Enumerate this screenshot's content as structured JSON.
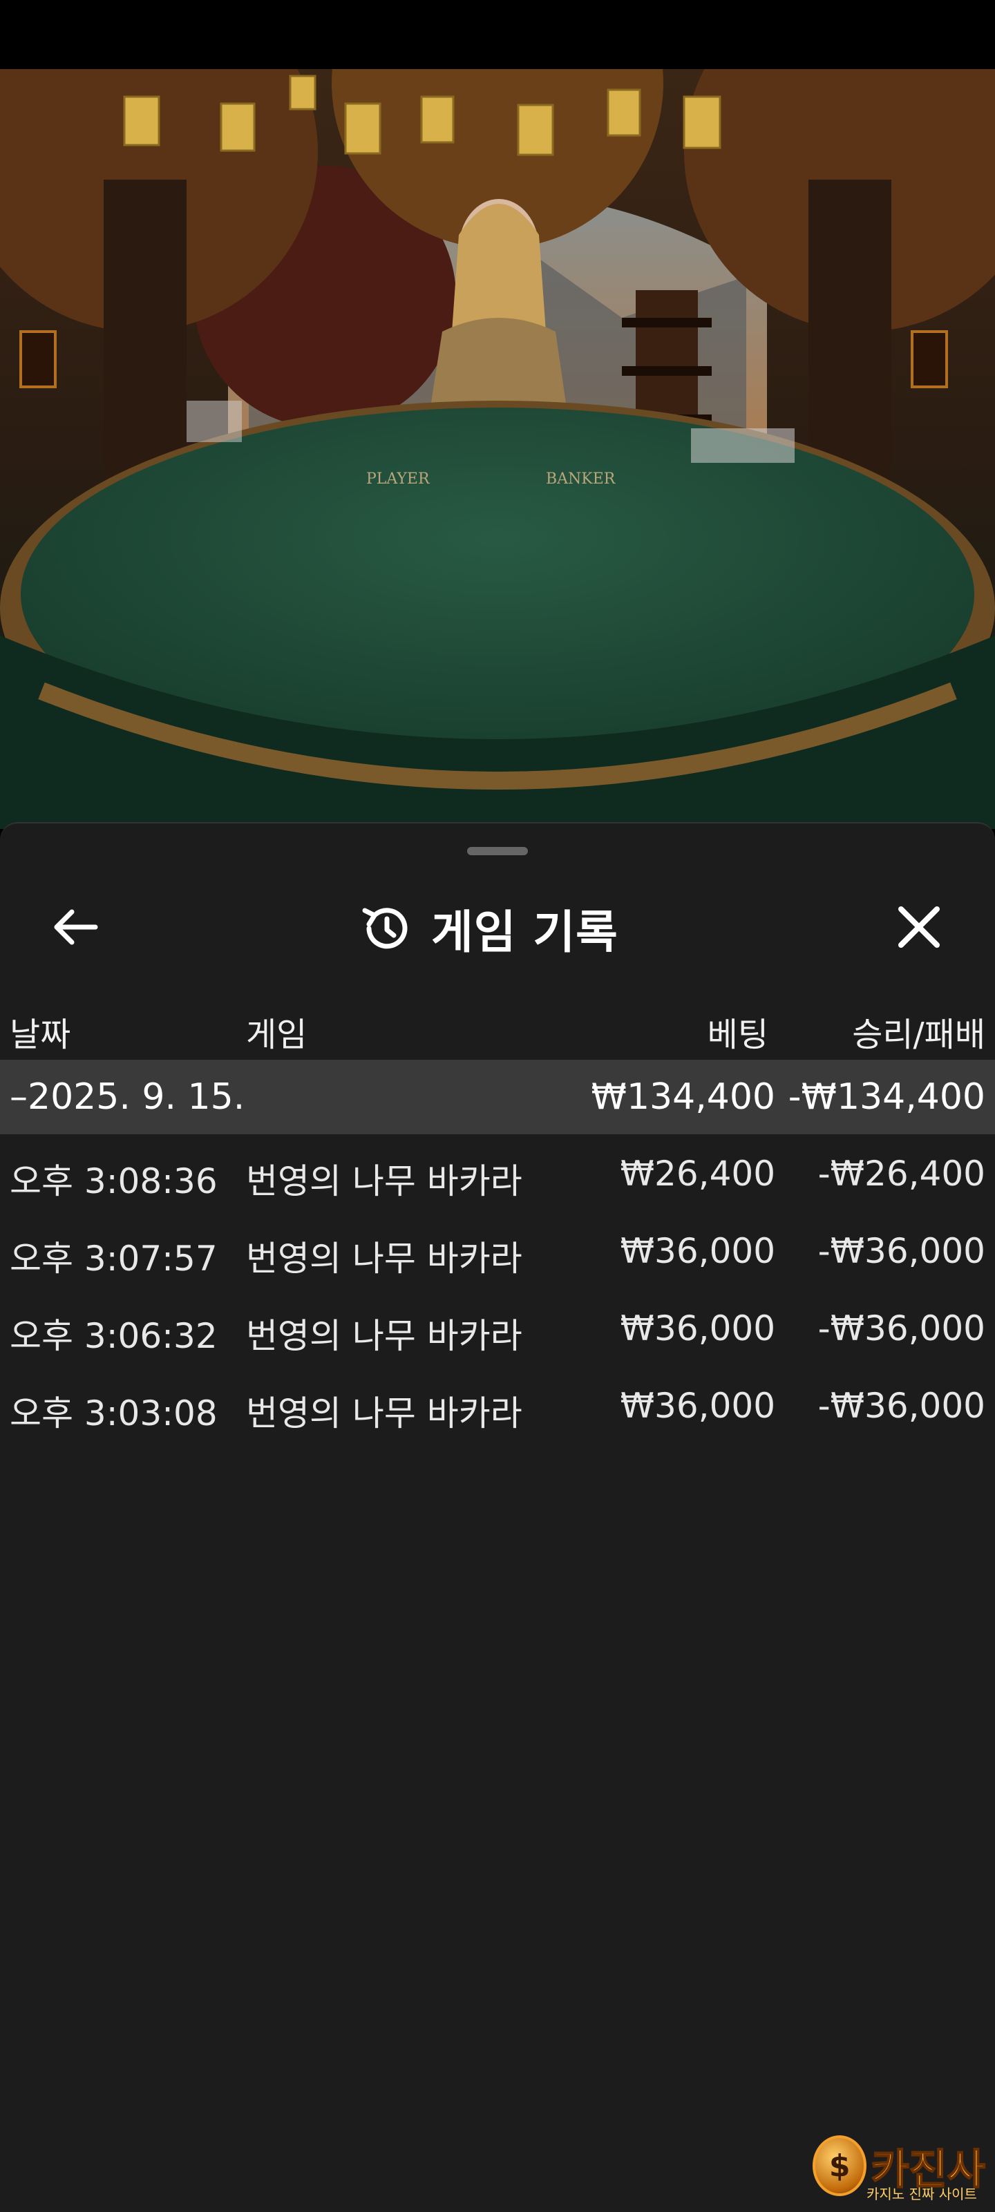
{
  "video": {
    "table_left_label": "PLAYER",
    "table_right_label": "BANKER"
  },
  "header": {
    "title": "게임 기록",
    "back_icon": "arrow-left-icon",
    "history_icon": "history-icon",
    "close_icon": "close-icon"
  },
  "columns": {
    "date": "날짜",
    "game": "게임",
    "bet": "베팅",
    "result": "승리/패배"
  },
  "date_group": {
    "label": "–2025. 9. 15.",
    "total_bet": "₩134,400",
    "total_result": "-₩134,400"
  },
  "rows": [
    {
      "time": "오후 3:08:36",
      "game": "번영의 나무 바카라",
      "bet": "₩26,400",
      "result": "-₩26,400"
    },
    {
      "time": "오후 3:07:57",
      "game": "번영의 나무 바카라",
      "bet": "₩36,000",
      "result": "-₩36,000"
    },
    {
      "time": "오후 3:06:32",
      "game": "번영의 나무 바카라",
      "bet": "₩36,000",
      "result": "-₩36,000"
    },
    {
      "time": "오후 3:03:08",
      "game": "번영의 나무 바카라",
      "bet": "₩36,000",
      "result": "-₩36,000"
    }
  ],
  "watermark": {
    "coin_symbol": "$",
    "brand": "카진사",
    "tagline": "카지노 진짜 사이트"
  },
  "colors": {
    "sheet_bg": "#1c1c1c",
    "date_row_bg": "#3a3a3a",
    "table_felt": "#1f4a36"
  }
}
